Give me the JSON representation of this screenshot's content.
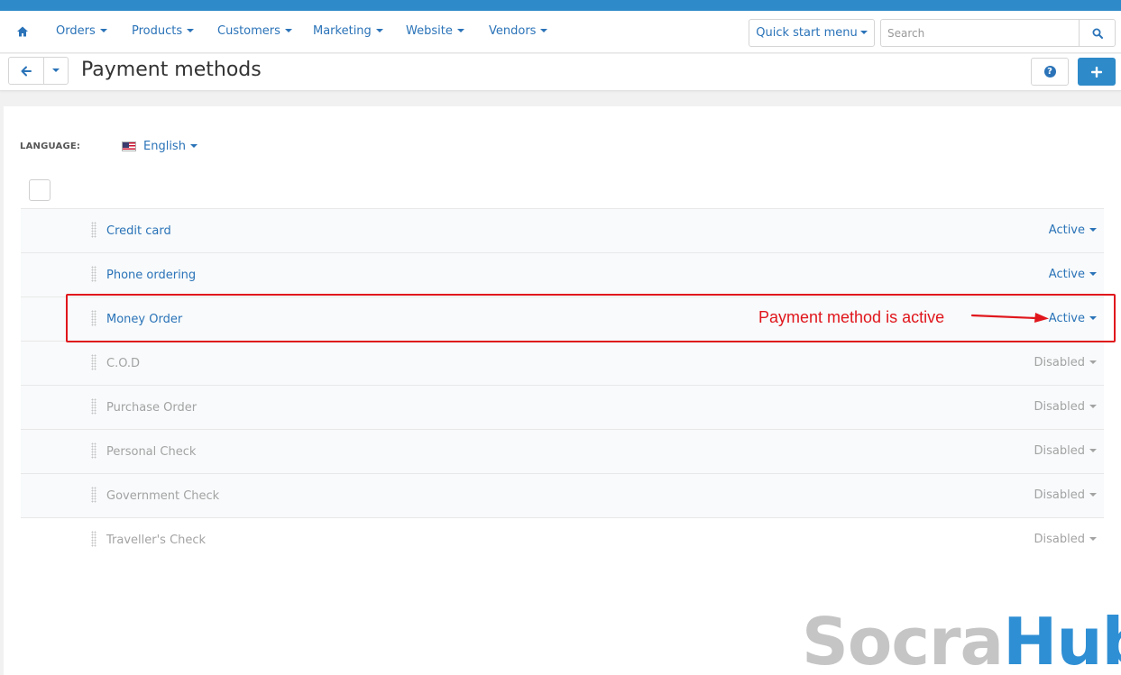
{
  "colors": {
    "accent": "#2e8ac9",
    "link": "#2a73b8",
    "disabled_text": "#a3a3a3",
    "annotation": "#e0161c"
  },
  "nav": {
    "home_icon": "home-icon",
    "items": [
      {
        "label": "Orders"
      },
      {
        "label": "Products"
      },
      {
        "label": "Customers"
      },
      {
        "label": "Marketing"
      },
      {
        "label": "Website"
      },
      {
        "label": "Vendors"
      }
    ],
    "quick_start_label": "Quick start menu",
    "search_placeholder": "Search",
    "search_icon": "search-icon"
  },
  "header": {
    "title": "Payment methods",
    "back_icon": "arrow-left-icon",
    "help_icon": "question-circle-icon",
    "add_icon": "plus-icon"
  },
  "language": {
    "label": "LANGUAGE:",
    "selected": "English",
    "flag_icon": "us-flag-icon"
  },
  "payment_methods": [
    {
      "name": "Credit card",
      "status": "Active"
    },
    {
      "name": "Phone ordering",
      "status": "Active"
    },
    {
      "name": "Money Order",
      "status": "Active"
    },
    {
      "name": "C.O.D",
      "status": "Disabled"
    },
    {
      "name": "Purchase Order",
      "status": "Disabled"
    },
    {
      "name": "Personal Check",
      "status": "Disabled"
    },
    {
      "name": "Government Check",
      "status": "Disabled"
    },
    {
      "name": "Traveller's Check",
      "status": "Disabled"
    }
  ],
  "annotation": {
    "text": "Payment method is active"
  },
  "watermark": {
    "part1": "Socra",
    "part2": "Hub"
  }
}
